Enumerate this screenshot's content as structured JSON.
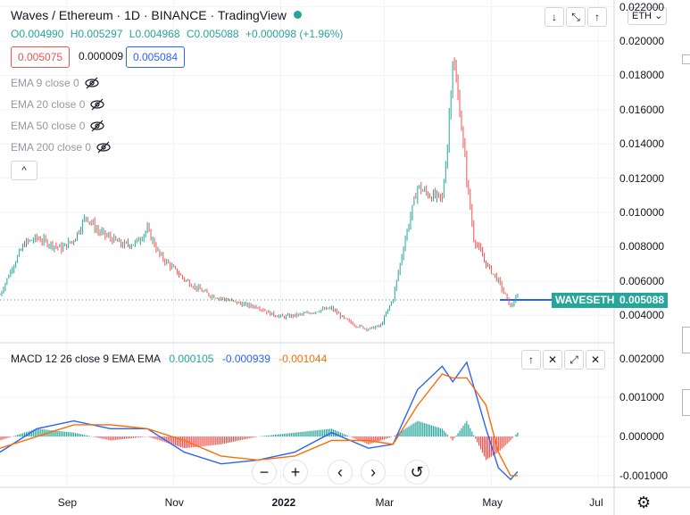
{
  "header": {
    "title": "Waves / Ethereum · 1D · BINANCE · TradingView",
    "status_color": "#26a69a",
    "ohlc": [
      "O0.004990",
      "H0.005297",
      "L0.004968",
      "C0.005088",
      "+0.000098 (+1.96%)"
    ],
    "price_bid": "0.005075",
    "spread": "0.000009",
    "price_ask": "0.005084"
  },
  "toolbar": {
    "unit": "ETH",
    "unit_arrow": "⌄",
    "collapse_icon": "^"
  },
  "window_buttons": {
    "down_icon": "↓",
    "expand_icon": "⤡",
    "up_icon": "↑"
  },
  "indicators": [
    {
      "label": "EMA 9 close 0"
    },
    {
      "label": "EMA 20 close 0"
    },
    {
      "label": "EMA 50 close 0"
    },
    {
      "label": "EMA 200 close 0"
    }
  ],
  "macd": {
    "label": "MACD 12 26 close 9 EMA EMA",
    "hist_value": "0.000105",
    "macd_value": "-0.000939",
    "signal_value": "-0.001044",
    "colors": {
      "hist": "#26a69a",
      "macd": "#2962ff",
      "signal": "#ff6d00"
    },
    "buttons": [
      "↑",
      "✕",
      "⤢",
      "✕"
    ]
  },
  "price_axis": {
    "labels": [
      "0.022000",
      "0.020000",
      "0.018000",
      "0.016000",
      "0.014000",
      "0.012000",
      "0.010000",
      "0.008000",
      "0.006000",
      "0.004000"
    ],
    "symbol_tag": "WAVESETH",
    "last_price": "0.005088",
    "tag_color": "#26a69a"
  },
  "macd_axis": {
    "labels": [
      "0.002000",
      "0.001000",
      "0.000000",
      "-0.001000"
    ]
  },
  "time_axis": {
    "labels": [
      "Sep",
      "Nov",
      "2022",
      "Mar",
      "May",
      "Jul"
    ]
  },
  "zoom_controls": {
    "zoom_out": "−",
    "zoom_in": "+",
    "prev": "‹",
    "next": "›",
    "reset": "↺"
  },
  "settings_icon": "⚙",
  "chart_data": {
    "type": "candlestick",
    "up_color": "#26a69a",
    "down_color": "#ef5350",
    "close_series": [
      [
        "2021-07-25",
        0.0052
      ],
      [
        "2021-08-01",
        0.0068
      ],
      [
        "2021-08-08",
        0.0082
      ],
      [
        "2021-08-15",
        0.0085
      ],
      [
        "2021-08-22",
        0.0082
      ],
      [
        "2021-08-29",
        0.0079
      ],
      [
        "2021-09-05",
        0.0084
      ],
      [
        "2021-09-12",
        0.0098
      ],
      [
        "2021-09-19",
        0.0089
      ],
      [
        "2021-09-26",
        0.0085
      ],
      [
        "2021-10-03",
        0.0081
      ],
      [
        "2021-10-10",
        0.0082
      ],
      [
        "2021-10-17",
        0.009
      ],
      [
        "2021-10-24",
        0.0075
      ],
      [
        "2021-10-31",
        0.0068
      ],
      [
        "2021-11-07",
        0.0061
      ],
      [
        "2021-11-14",
        0.0056
      ],
      [
        "2021-11-21",
        0.0052
      ],
      [
        "2021-11-28",
        0.005
      ],
      [
        "2021-12-05",
        0.0048
      ],
      [
        "2021-12-12",
        0.0046
      ],
      [
        "2021-12-19",
        0.0045
      ],
      [
        "2021-12-26",
        0.0041
      ],
      [
        "2022-01-02",
        0.0039
      ],
      [
        "2022-01-09",
        0.004
      ],
      [
        "2022-01-16",
        0.0041
      ],
      [
        "2022-01-23",
        0.0043
      ],
      [
        "2022-01-30",
        0.0044
      ],
      [
        "2022-02-06",
        0.0038
      ],
      [
        "2022-02-13",
        0.0034
      ],
      [
        "2022-02-20",
        0.0032
      ],
      [
        "2022-02-27",
        0.0034
      ],
      [
        "2022-03-06",
        0.005
      ],
      [
        "2022-03-13",
        0.0085
      ],
      [
        "2022-03-20",
        0.0115
      ],
      [
        "2022-03-27",
        0.011
      ],
      [
        "2022-04-03",
        0.0108
      ],
      [
        "2022-04-06",
        0.014
      ],
      [
        "2022-04-09",
        0.019
      ],
      [
        "2022-04-13",
        0.016
      ],
      [
        "2022-04-17",
        0.012
      ],
      [
        "2022-04-21",
        0.0085
      ],
      [
        "2022-04-28",
        0.007
      ],
      [
        "2022-05-05",
        0.006
      ],
      [
        "2022-05-12",
        0.0045
      ],
      [
        "2022-05-16",
        0.0051
      ]
    ],
    "macd_series": [
      [
        "2021-07-25",
        -0.0004
      ],
      [
        "2021-08-15",
        0.0002
      ],
      [
        "2021-09-05",
        0.0004
      ],
      [
        "2021-09-26",
        0.0002
      ],
      [
        "2021-10-17",
        0.0002
      ],
      [
        "2021-11-07",
        -0.0004
      ],
      [
        "2021-11-28",
        -0.0007
      ],
      [
        "2021-12-19",
        -0.0006
      ],
      [
        "2022-01-09",
        -0.0004
      ],
      [
        "2022-01-30",
        0.0001
      ],
      [
        "2022-02-20",
        -0.0003
      ],
      [
        "2022-03-06",
        -0.0002
      ],
      [
        "2022-03-20",
        0.0012
      ],
      [
        "2022-04-03",
        0.0018
      ],
      [
        "2022-04-09",
        0.0014
      ],
      [
        "2022-04-17",
        0.0019
      ],
      [
        "2022-04-28",
        0.0002
      ],
      [
        "2022-05-05",
        -0.0008
      ],
      [
        "2022-05-12",
        -0.0011
      ],
      [
        "2022-05-16",
        -0.0009
      ]
    ],
    "signal_series": [
      [
        "2021-07-25",
        -0.0003
      ],
      [
        "2021-08-15",
        0.0
      ],
      [
        "2021-09-05",
        0.0003
      ],
      [
        "2021-09-26",
        0.0003
      ],
      [
        "2021-10-17",
        0.0002
      ],
      [
        "2021-11-07",
        -0.0001
      ],
      [
        "2021-11-28",
        -0.0005
      ],
      [
        "2021-12-19",
        -0.0006
      ],
      [
        "2022-01-09",
        -0.0005
      ],
      [
        "2022-01-30",
        -0.0001
      ],
      [
        "2022-02-20",
        -0.0001
      ],
      [
        "2022-03-06",
        -0.0002
      ],
      [
        "2022-03-20",
        0.0008
      ],
      [
        "2022-04-03",
        0.0016
      ],
      [
        "2022-04-09",
        0.0015
      ],
      [
        "2022-04-17",
        0.0015
      ],
      [
        "2022-04-28",
        0.0008
      ],
      [
        "2022-05-05",
        -0.0004
      ],
      [
        "2022-05-12",
        -0.001
      ],
      [
        "2022-05-16",
        -0.001
      ]
    ],
    "price_ylim": [
      0.0024,
      0.0224
    ],
    "macd_ylim": [
      -0.0013,
      0.0024
    ]
  }
}
